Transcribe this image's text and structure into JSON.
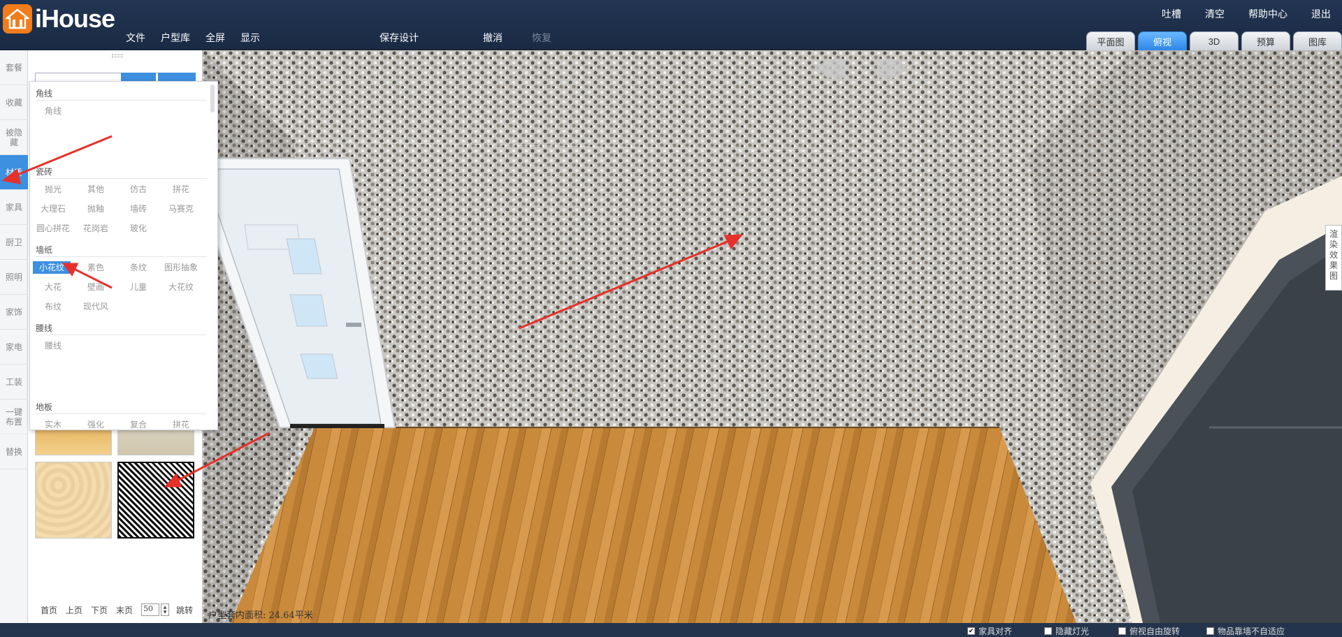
{
  "app": {
    "name": "iHouse"
  },
  "menu": {
    "file": "文件",
    "floorplans": "户型库",
    "fullscreen": "全屏",
    "display": "显示",
    "save": "保存设计",
    "undo": "撤消",
    "redo": "恢复"
  },
  "top_right": {
    "feedback": "吐槽",
    "clear": "清空",
    "help": "帮助中心",
    "logout": "退出"
  },
  "view_tabs": [
    "平面图",
    "俯视",
    "3D",
    "预算",
    "图库"
  ],
  "left_nav": [
    "套餐",
    "收藏",
    "被隐藏",
    "材质",
    "家具",
    "厨卫",
    "照明",
    "家饰",
    "家电",
    "工装",
    "一键布置",
    "替换"
  ],
  "dropdown": {
    "corner_line": {
      "title": "角线",
      "items": [
        "角线"
      ]
    },
    "tile": {
      "title": "瓷砖",
      "items": [
        "抛光",
        "其他",
        "仿古",
        "拼花",
        "大理石",
        "抛釉",
        "墙砖",
        "马赛克",
        "圆心拼花",
        "花岗岩",
        "玻化"
      ]
    },
    "wallpaper": {
      "title": "墙纸",
      "items": [
        "小花纹",
        "素色",
        "条纹",
        "图形抽象",
        "大花",
        "壁画",
        "儿童",
        "大花纹",
        "布纹",
        "现代风"
      ]
    },
    "waist_line": {
      "title": "腰线",
      "items": [
        "腰线"
      ]
    },
    "floor": {
      "title": "地板",
      "items": [
        "实木",
        "强化",
        "复合",
        "拼花"
      ]
    }
  },
  "pager": {
    "first": "首页",
    "prev": "上页",
    "next": "下页",
    "last": "末页",
    "page_size": "50",
    "go": "跳转"
  },
  "scene": {
    "area_text": "户型套内面积: 24.64平米",
    "render_tab": "渲染效果图"
  },
  "status": {
    "snap_furniture": "家具对齐",
    "hide_lights": "隐藏灯光",
    "free_rotate": "俯视自由旋转",
    "no_wall_adapt": "物品靠墙不自适应"
  },
  "colors": {
    "accent": "#3d8fe0",
    "header": "#1f3150",
    "logo": "#f07c1b",
    "floor": "#c98a3c",
    "arrow": "#e8302a"
  }
}
